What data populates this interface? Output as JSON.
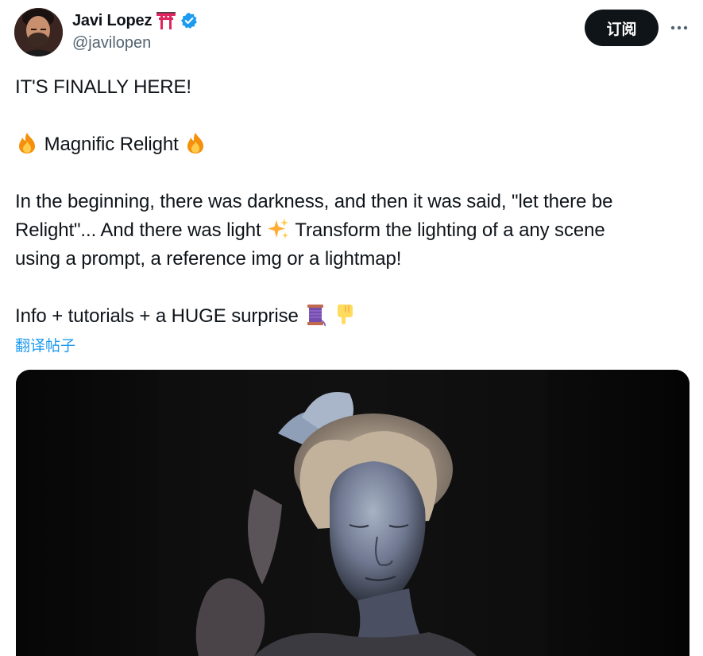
{
  "author": {
    "display_name": "Javi Lopez",
    "handle": "@javilopen",
    "name_badge_icon": "torii-gate-icon",
    "verified_icon": "verified-badge-icon",
    "verified_color": "#1d9bf0"
  },
  "actions": {
    "subscribe_label": "订阅",
    "more_icon": "more-horizontal-icon"
  },
  "tweet": {
    "line1": "IT'S FINALLY HERE!",
    "title": {
      "text": "Magnific Relight",
      "leading_icon": "fire-emoji",
      "trailing_icon": "fire-emoji"
    },
    "paragraph": {
      "line1": "In the beginning, there was darkness, and then it was said, \"let there be",
      "line2a": "Relight\"... And there was light",
      "line2_icon": "sparkles-emoji",
      "line2b": "Transform the lighting of a any scene",
      "line3": "using a prompt, a reference img or a lightmap!"
    },
    "closing": {
      "text": "Info + tutorials + a HUGE surprise",
      "icons": [
        "thread-spool-emoji",
        "pointing-down-emoji"
      ]
    },
    "translate_label": "翻译帖子"
  },
  "media": {
    "kind": "image",
    "subject": "sculpture-bust-image",
    "background": "#050505"
  },
  "colors": {
    "text": "#0f1419",
    "secondary": "#536471",
    "link": "#1d9bf0",
    "button_bg": "#0f1419",
    "button_text": "#ffffff"
  }
}
